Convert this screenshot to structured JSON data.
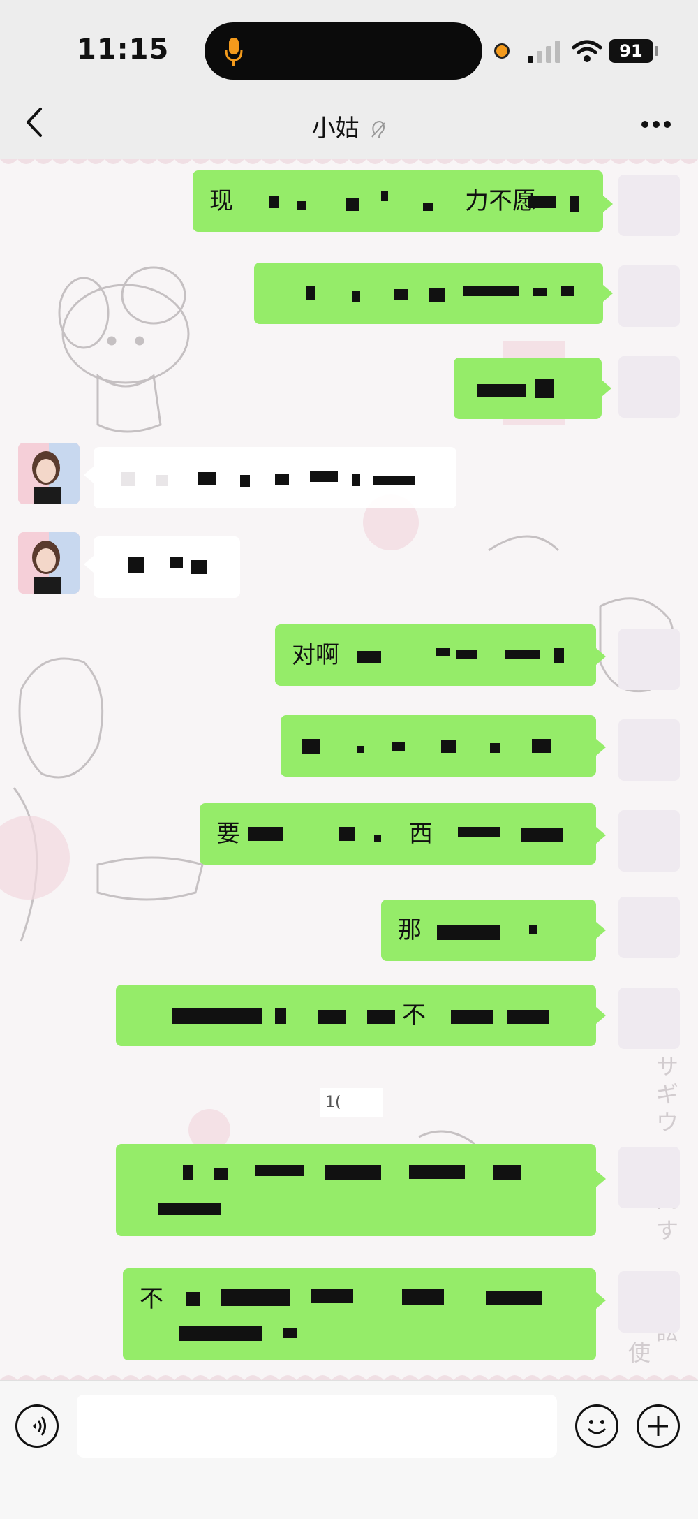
{
  "status_bar": {
    "time": "11:15",
    "battery": "91",
    "icons": [
      "microphone-icon",
      "recording-dot-icon",
      "signal-icon",
      "wifi-icon",
      "battery-icon"
    ],
    "colors": {
      "mic": "#f39a1c",
      "recording_dot": "#f39a1c"
    }
  },
  "nav": {
    "back_icon": "chevron-left-icon",
    "title": "小姑",
    "title_icon": "muted-ear-icon",
    "more_icon": "more-dots-icon"
  },
  "chat": {
    "colors": {
      "sent_bubble": "#95ec69",
      "received_bubble": "#ffffff"
    },
    "messages": [
      {
        "side": "sent",
        "text_visible": "现",
        "text_visible_2": "力不愿"
      },
      {
        "side": "sent",
        "text_visible": ""
      },
      {
        "side": "sent",
        "text_visible": ""
      },
      {
        "side": "received",
        "text_visible": ""
      },
      {
        "side": "received",
        "text_visible": ""
      },
      {
        "side": "sent",
        "text_visible": "对啊"
      },
      {
        "side": "sent",
        "text_visible": ""
      },
      {
        "side": "sent",
        "text_visible": "要",
        "text_visible_2": "西"
      },
      {
        "side": "sent",
        "text_visible": "那"
      },
      {
        "side": "sent",
        "text_visible": "",
        "text_visible_2": "不"
      },
      {
        "side": "sent",
        "text_visible": ""
      },
      {
        "side": "sent",
        "text_visible": "不"
      }
    ],
    "timestamp_partial": "1("
  },
  "input_bar": {
    "voice_icon": "voice-input-icon",
    "input_value": "",
    "emoji_icon": "emoji-icon",
    "plus_icon": "plus-icon"
  }
}
